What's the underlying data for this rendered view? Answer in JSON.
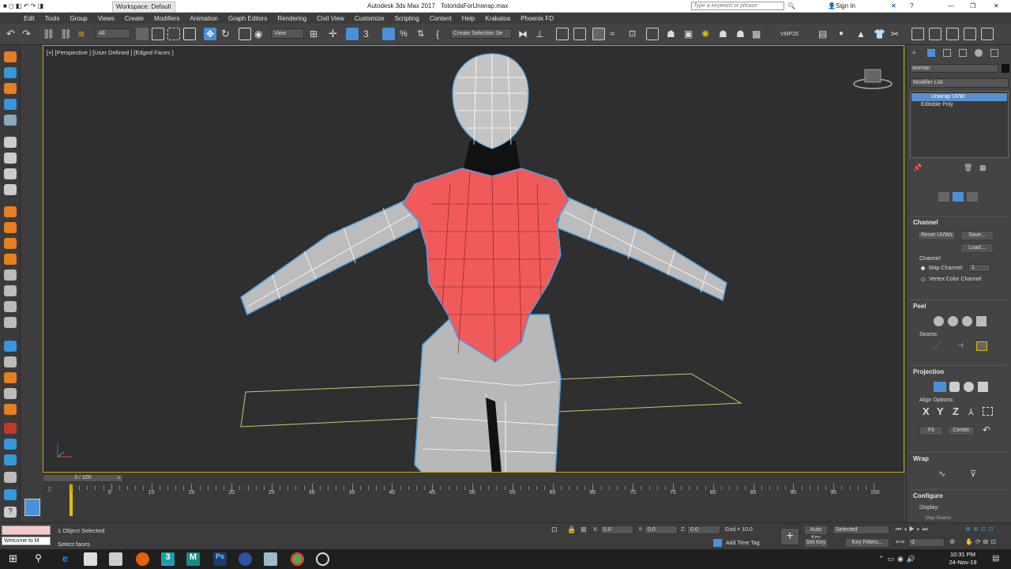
{
  "titlebar": {
    "workspace": "Workspace: Default",
    "app_title": "Autodesk 3ds Max 2017",
    "file": "TotoridaForUnwrap.max",
    "search_placeholder": "Type a keyword or phrase",
    "sign_in": "Sign In"
  },
  "menu": [
    "Edit",
    "Tools",
    "Group",
    "Views",
    "Create",
    "Modifiers",
    "Animation",
    "Graph Editors",
    "Rendering",
    "Civil View",
    "Customize",
    "Scripting",
    "Content",
    "Help",
    "Krakatoa",
    "Phoenix FD"
  ],
  "toolbar": {
    "filter": "All",
    "view": "View",
    "create_selection_set": "Create Selection Se",
    "vmp": "VMP25"
  },
  "viewport": {
    "label": "[+] [Perspective ] [User Defined ] [Edged Faces ]"
  },
  "cmdpanel": {
    "object_name": "woman",
    "modifier_list": "Modifier List",
    "stack": [
      "Unwrap UVW",
      "Editable Poly"
    ],
    "channel": {
      "title": "Channel",
      "reset": "Reset UVWs",
      "save": "Save...",
      "load": "Load...",
      "channel_label": "Channel:",
      "map_channel": "Map Channel:",
      "map_channel_value": "1",
      "vertex_color": "Vertex Color Channel"
    },
    "peel": {
      "title": "Peel",
      "seams": "Seams:"
    },
    "projection": {
      "title": "Projection",
      "align_options": "Align Options:",
      "x": "X",
      "y": "Y",
      "z": "Z",
      "fit": "Fit",
      "center": "Center"
    },
    "wrap": {
      "title": "Wrap"
    },
    "configure": {
      "title": "Configure",
      "display": "Display:",
      "map_seams": "Map Seams"
    }
  },
  "timeline": {
    "frame": "0 / 100",
    "ticks": [
      "5",
      "10",
      "15",
      "20",
      "25",
      "30",
      "35",
      "40",
      "45",
      "50",
      "55",
      "60",
      "65",
      "70",
      "75",
      "80",
      "85",
      "90",
      "95",
      "100"
    ]
  },
  "status": {
    "maxscript": "Welcome to M",
    "selected": "1 Object Selected",
    "prompt": "Select faces",
    "x_label": "X:",
    "x_val": "0.0",
    "y_label": "Y:",
    "y_val": "0.0",
    "z_label": "Z:",
    "z_val": "0.0",
    "grid": "Grid = 10.0",
    "add_time_tag": "Add Time Tag",
    "auto_key": "Auto Key",
    "set_key": "Set Key",
    "selected_dd": "Selected",
    "key_filters": "Key Filters...",
    "frame_field": "0"
  },
  "taskbar": {
    "time": "10:31 PM",
    "date": "24-Nov-19"
  },
  "colors": {
    "accent": "#4a90d9",
    "selection_red": "#f05a5a",
    "viewport_border": "#c8a800"
  }
}
